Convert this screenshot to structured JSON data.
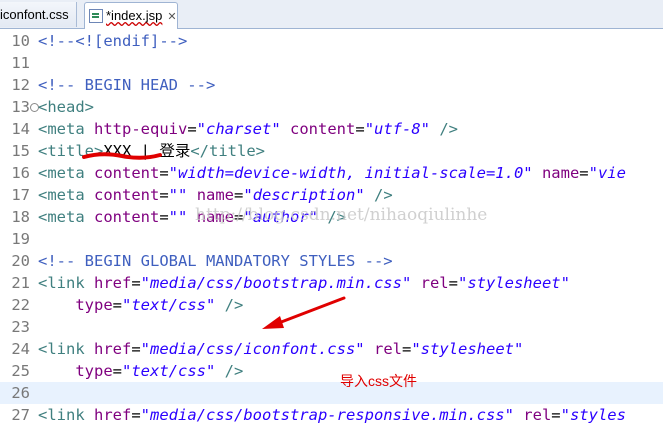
{
  "tabs": [
    {
      "label": "iconfont.css"
    },
    {
      "label": "*index.jsp",
      "close": "✕"
    }
  ],
  "lines": [
    {
      "num": "10",
      "tokens": [
        {
          "t": "cmt",
          "v": "<!--<![endif]-->"
        }
      ]
    },
    {
      "num": "11",
      "tokens": []
    },
    {
      "num": "12",
      "tokens": [
        {
          "t": "cmt",
          "v": "<!-- BEGIN HEAD -->"
        }
      ]
    },
    {
      "num": "13",
      "fold": "⊖",
      "tokens": [
        {
          "t": "tag",
          "v": "<head>"
        }
      ]
    },
    {
      "num": "14",
      "tokens": [
        {
          "t": "tag",
          "v": "<meta "
        },
        {
          "t": "attr",
          "v": "http-equiv"
        },
        {
          "t": "txt",
          "v": "="
        },
        {
          "t": "val",
          "v": "\"charset\""
        },
        {
          "t": "txt",
          "v": " "
        },
        {
          "t": "attr",
          "v": "content"
        },
        {
          "t": "txt",
          "v": "="
        },
        {
          "t": "val",
          "v": "\"utf-8\""
        },
        {
          "t": "tag",
          "v": " />"
        }
      ]
    },
    {
      "num": "15",
      "tokens": [
        {
          "t": "tag",
          "v": "<title>"
        },
        {
          "t": "txt",
          "v": "XXX | 登录"
        },
        {
          "t": "tag",
          "v": "</title>"
        }
      ]
    },
    {
      "num": "16",
      "tokens": [
        {
          "t": "tag",
          "v": "<meta "
        },
        {
          "t": "attr",
          "v": "content"
        },
        {
          "t": "txt",
          "v": "="
        },
        {
          "t": "val",
          "v": "\"width=device-width, initial-scale=1.0\""
        },
        {
          "t": "txt",
          "v": " "
        },
        {
          "t": "attr",
          "v": "name"
        },
        {
          "t": "txt",
          "v": "="
        },
        {
          "t": "val",
          "v": "\"vie"
        }
      ]
    },
    {
      "num": "17",
      "tokens": [
        {
          "t": "tag",
          "v": "<meta "
        },
        {
          "t": "attr",
          "v": "content"
        },
        {
          "t": "txt",
          "v": "="
        },
        {
          "t": "val",
          "v": "\"\""
        },
        {
          "t": "txt",
          "v": " "
        },
        {
          "t": "attr",
          "v": "name"
        },
        {
          "t": "txt",
          "v": "="
        },
        {
          "t": "val",
          "v": "\"description\""
        },
        {
          "t": "tag",
          "v": " />"
        }
      ]
    },
    {
      "num": "18",
      "tokens": [
        {
          "t": "tag",
          "v": "<meta "
        },
        {
          "t": "attr",
          "v": "content"
        },
        {
          "t": "txt",
          "v": "="
        },
        {
          "t": "val",
          "v": "\"\""
        },
        {
          "t": "txt",
          "v": " "
        },
        {
          "t": "attr",
          "v": "name"
        },
        {
          "t": "txt",
          "v": "="
        },
        {
          "t": "val",
          "v": "\"author\""
        },
        {
          "t": "tag",
          "v": " />"
        }
      ]
    },
    {
      "num": "19",
      "tokens": []
    },
    {
      "num": "20",
      "tokens": [
        {
          "t": "cmt",
          "v": "<!-- BEGIN GLOBAL MANDATORY STYLES -->"
        }
      ]
    },
    {
      "num": "21",
      "tokens": [
        {
          "t": "tag",
          "v": "<link "
        },
        {
          "t": "attr",
          "v": "href"
        },
        {
          "t": "txt",
          "v": "="
        },
        {
          "t": "val",
          "v": "\"media/css/bootstrap.min.css\""
        },
        {
          "t": "txt",
          "v": " "
        },
        {
          "t": "attr",
          "v": "rel"
        },
        {
          "t": "txt",
          "v": "="
        },
        {
          "t": "val",
          "v": "\"stylesheet\""
        }
      ]
    },
    {
      "num": "22",
      "tokens": [
        {
          "t": "txt",
          "v": "    "
        },
        {
          "t": "attr",
          "v": "type"
        },
        {
          "t": "txt",
          "v": "="
        },
        {
          "t": "val",
          "v": "\"text/css\""
        },
        {
          "t": "tag",
          "v": " />"
        }
      ]
    },
    {
      "num": "23",
      "tokens": []
    },
    {
      "num": "24",
      "tokens": [
        {
          "t": "tag",
          "v": "<link "
        },
        {
          "t": "attr",
          "v": "href"
        },
        {
          "t": "txt",
          "v": "="
        },
        {
          "t": "val",
          "v": "\"media/css/iconfont.css\""
        },
        {
          "t": "txt",
          "v": " "
        },
        {
          "t": "attr",
          "v": "rel"
        },
        {
          "t": "txt",
          "v": "="
        },
        {
          "t": "val",
          "v": "\"stylesheet\""
        }
      ]
    },
    {
      "num": "25",
      "tokens": [
        {
          "t": "txt",
          "v": "    "
        },
        {
          "t": "attr",
          "v": "type"
        },
        {
          "t": "txt",
          "v": "="
        },
        {
          "t": "val",
          "v": "\"text/css\""
        },
        {
          "t": "tag",
          "v": " />"
        }
      ]
    },
    {
      "num": "26",
      "current": true,
      "tokens": []
    },
    {
      "num": "27",
      "tokens": [
        {
          "t": "tag",
          "v": "<link "
        },
        {
          "t": "attr",
          "v": "href"
        },
        {
          "t": "txt",
          "v": "="
        },
        {
          "t": "val",
          "v": "\"media/css/bootstrap-responsive.min.css\""
        },
        {
          "t": "txt",
          "v": " "
        },
        {
          "t": "attr",
          "v": "rel"
        },
        {
          "t": "txt",
          "v": "="
        },
        {
          "t": "val",
          "v": "\"styles"
        }
      ]
    }
  ],
  "watermark": "http://blog.csdn.net/nihaoqiulinhe",
  "annotation": "导入css文件",
  "colors": {
    "tag": "#3f7f7f",
    "attr": "#7f007f",
    "value": "#2a00ff",
    "comment": "#3f5fbf",
    "annotation": "#e00000"
  }
}
